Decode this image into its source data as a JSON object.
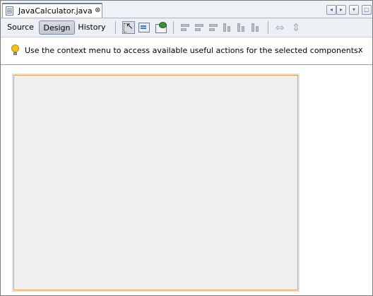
{
  "editor": {
    "tab_label": "JavaCalculator.java",
    "tab_close": "⊗",
    "nav": {
      "left": "◂",
      "right": "▸",
      "down": "▾",
      "max": "□"
    }
  },
  "toolbar": {
    "views": [
      {
        "label": "Source",
        "active": false
      },
      {
        "label": "Design",
        "active": true
      },
      {
        "label": "History",
        "active": false
      }
    ],
    "icons": [
      "selection-mode-icon",
      "connection-mode-icon",
      "preview-design-icon",
      "align-left-icon",
      "align-right-icon",
      "center-horizontally-icon",
      "align-top-icon",
      "align-bottom-icon",
      "center-vertically-icon",
      "change-horizontal-resizability-icon",
      "change-vertical-resizability-icon"
    ],
    "resize_h": "⇔",
    "resize_v": "⇕"
  },
  "hint": {
    "text": "Use the context menu to access available useful actions for the selected components.",
    "close": "x"
  },
  "colors": {
    "form_border": "#f0a43a",
    "form_background": "#efefef"
  }
}
